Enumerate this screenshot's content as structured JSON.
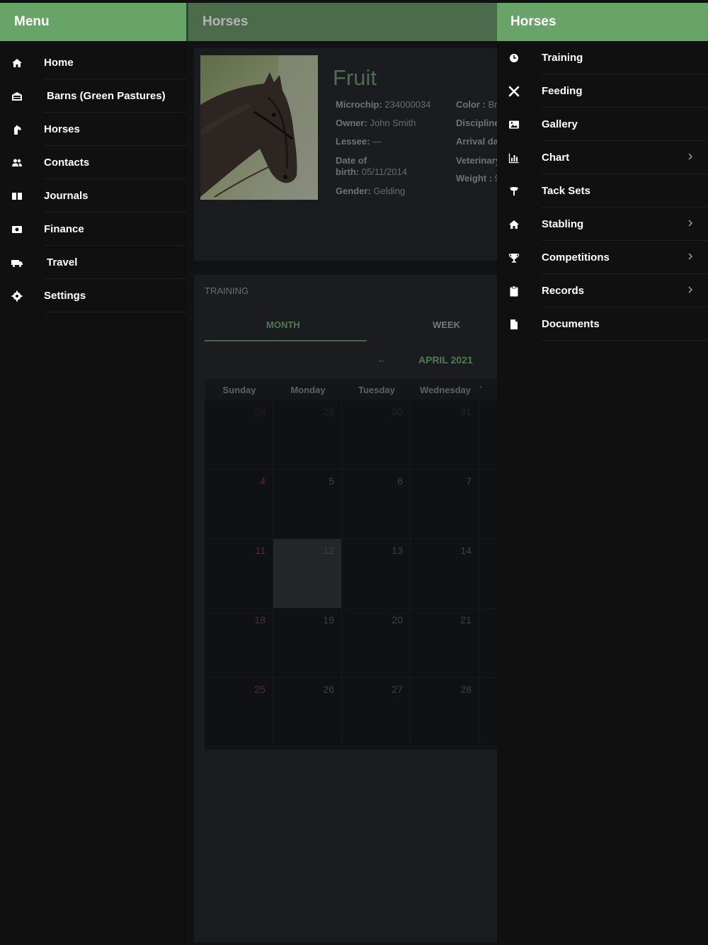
{
  "left_menu": {
    "title": "Menu",
    "items": [
      {
        "label": "Home",
        "icon": "home-icon"
      },
      {
        "label": "Barns (Green Pastures)",
        "icon": "barn-icon"
      },
      {
        "label": "Horses",
        "icon": "horse-icon"
      },
      {
        "label": "Contacts",
        "icon": "contacts-icon"
      },
      {
        "label": "Journals",
        "icon": "journal-icon"
      },
      {
        "label": "Finance",
        "icon": "finance-icon"
      },
      {
        "label": "Travel",
        "icon": "travel-icon"
      },
      {
        "label": "Settings",
        "icon": "settings-icon"
      }
    ]
  },
  "center": {
    "title": "Horses",
    "horse": {
      "name": "Fruit",
      "microchip_label": "Microchip:",
      "microchip_value": "234000034",
      "owner_label": "Owner:",
      "owner_value": "John Smith",
      "lessee_label": "Lessee:",
      "lessee_value": "—",
      "dob_label_1": "Date of",
      "dob_label_2": "birth:",
      "dob_value": "05/11/2014",
      "gender_label": "Gender:",
      "gender_value": "Gelding",
      "color_label": "Color :",
      "color_value": "Br",
      "discipline_label": "Discipline",
      "arrival_label": "Arrival da",
      "veterinary_label": "Veterinary",
      "weight_label": "Weight :",
      "weight_value": "9"
    },
    "training": {
      "title": "TRAINING",
      "tab_month": "MONTH",
      "tab_week": "WEEK",
      "nav_arrow": "←",
      "month_label": "APRIL 2021",
      "weekdays": [
        "Sunday",
        "Monday",
        "Tuesday",
        "Wednesday"
      ],
      "weeks": [
        [
          "28",
          "29",
          "30",
          "31"
        ],
        [
          "4",
          "5",
          "6",
          "7"
        ],
        [
          "11",
          "12",
          "13",
          "14"
        ],
        [
          "18",
          "19",
          "20",
          "21"
        ],
        [
          "25",
          "26",
          "27",
          "28"
        ]
      ]
    }
  },
  "right_panel": {
    "title": "Horses",
    "items": [
      {
        "label": "Training",
        "icon": "clock-icon",
        "has_submenu": false
      },
      {
        "label": "Feeding",
        "icon": "utensils-icon",
        "has_submenu": false
      },
      {
        "label": "Gallery",
        "icon": "image-icon",
        "has_submenu": false
      },
      {
        "label": "Chart",
        "icon": "chart-icon",
        "has_submenu": true
      },
      {
        "label": "Tack Sets",
        "icon": "tack-icon",
        "has_submenu": false
      },
      {
        "label": "Stabling",
        "icon": "stable-icon",
        "has_submenu": true
      },
      {
        "label": "Competitions",
        "icon": "trophy-icon",
        "has_submenu": true
      },
      {
        "label": "Records",
        "icon": "clipboard-icon",
        "has_submenu": true
      },
      {
        "label": "Documents",
        "icon": "document-icon",
        "has_submenu": false
      }
    ]
  },
  "colors": {
    "accent_green": "#68a467",
    "dim_green": "#4b6b4b",
    "sunday_red": "#5a2a2c",
    "background": "#101011"
  }
}
